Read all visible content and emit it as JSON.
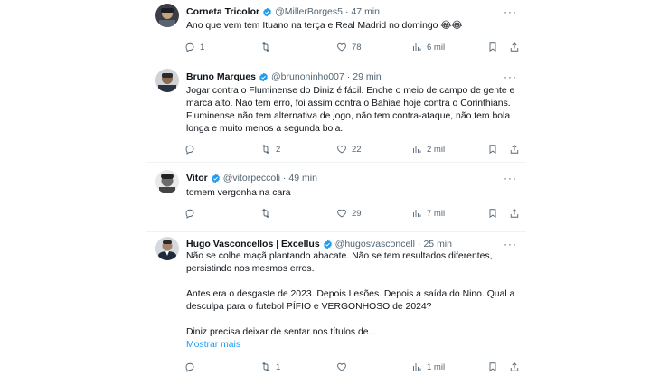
{
  "tweets": [
    {
      "name": "Corneta Tricolor",
      "handle": "@MillerBorges5",
      "time": "47 min",
      "text": "Ano que vem tem Ituano na terça e Real Madrid no domingo 😂😂",
      "replies": "1",
      "retweets": "",
      "likes": "78",
      "views": "6 mil"
    },
    {
      "name": "Bruno Marques",
      "handle": "@brunoninho007",
      "time": "29 min",
      "text": "Jogar contra o Fluminense do Diniz é fácil. Enche o meio de campo de gente e marca alto. Nao tem erro, foi assim contra o Bahiae hoje contra o Corinthians. Fluminense não tem alternativa de jogo, não tem contra-ataque, não tem bola longa e muito menos a segunda bola.",
      "replies": "",
      "retweets": "2",
      "likes": "22",
      "views": "2 mil"
    },
    {
      "name": "Vitor",
      "handle": "@vitorpeccoli",
      "time": "49 min",
      "text": "tomem vergonha na cara",
      "replies": "",
      "retweets": "",
      "likes": "29",
      "views": "7 mil"
    },
    {
      "name": "Hugo Vasconcellos | Excellus",
      "handle": "@hugosvasconcell",
      "time": "25 min",
      "text": "Não se colhe maçã plantando abacate. Não se tem resultados diferentes, persistindo nos mesmos erros.\n\nAntes era o desgaste de 2023. Depois Lesões. Depois a saída do Nino. Qual a desculpa para o futebol PÍFIO e VERGONHOSO de 2024?\n\nDiniz precisa deixar de sentar nos títulos de...",
      "show_more": "Mostrar mais",
      "replies": "",
      "retweets": "1",
      "likes": "",
      "views": "1 mil"
    }
  ],
  "icons": {
    "reply": "reply-icon",
    "retweet": "retweet-icon",
    "like": "heart-icon",
    "views": "views-icon",
    "bookmark": "bookmark-icon",
    "share": "share-icon",
    "verified": "verified-badge-icon",
    "more": "more-options-icon"
  },
  "colors": {
    "verified": "#1d9bf0",
    "link": "#1d9bf0",
    "muted": "#536471",
    "text": "#0f1419"
  }
}
